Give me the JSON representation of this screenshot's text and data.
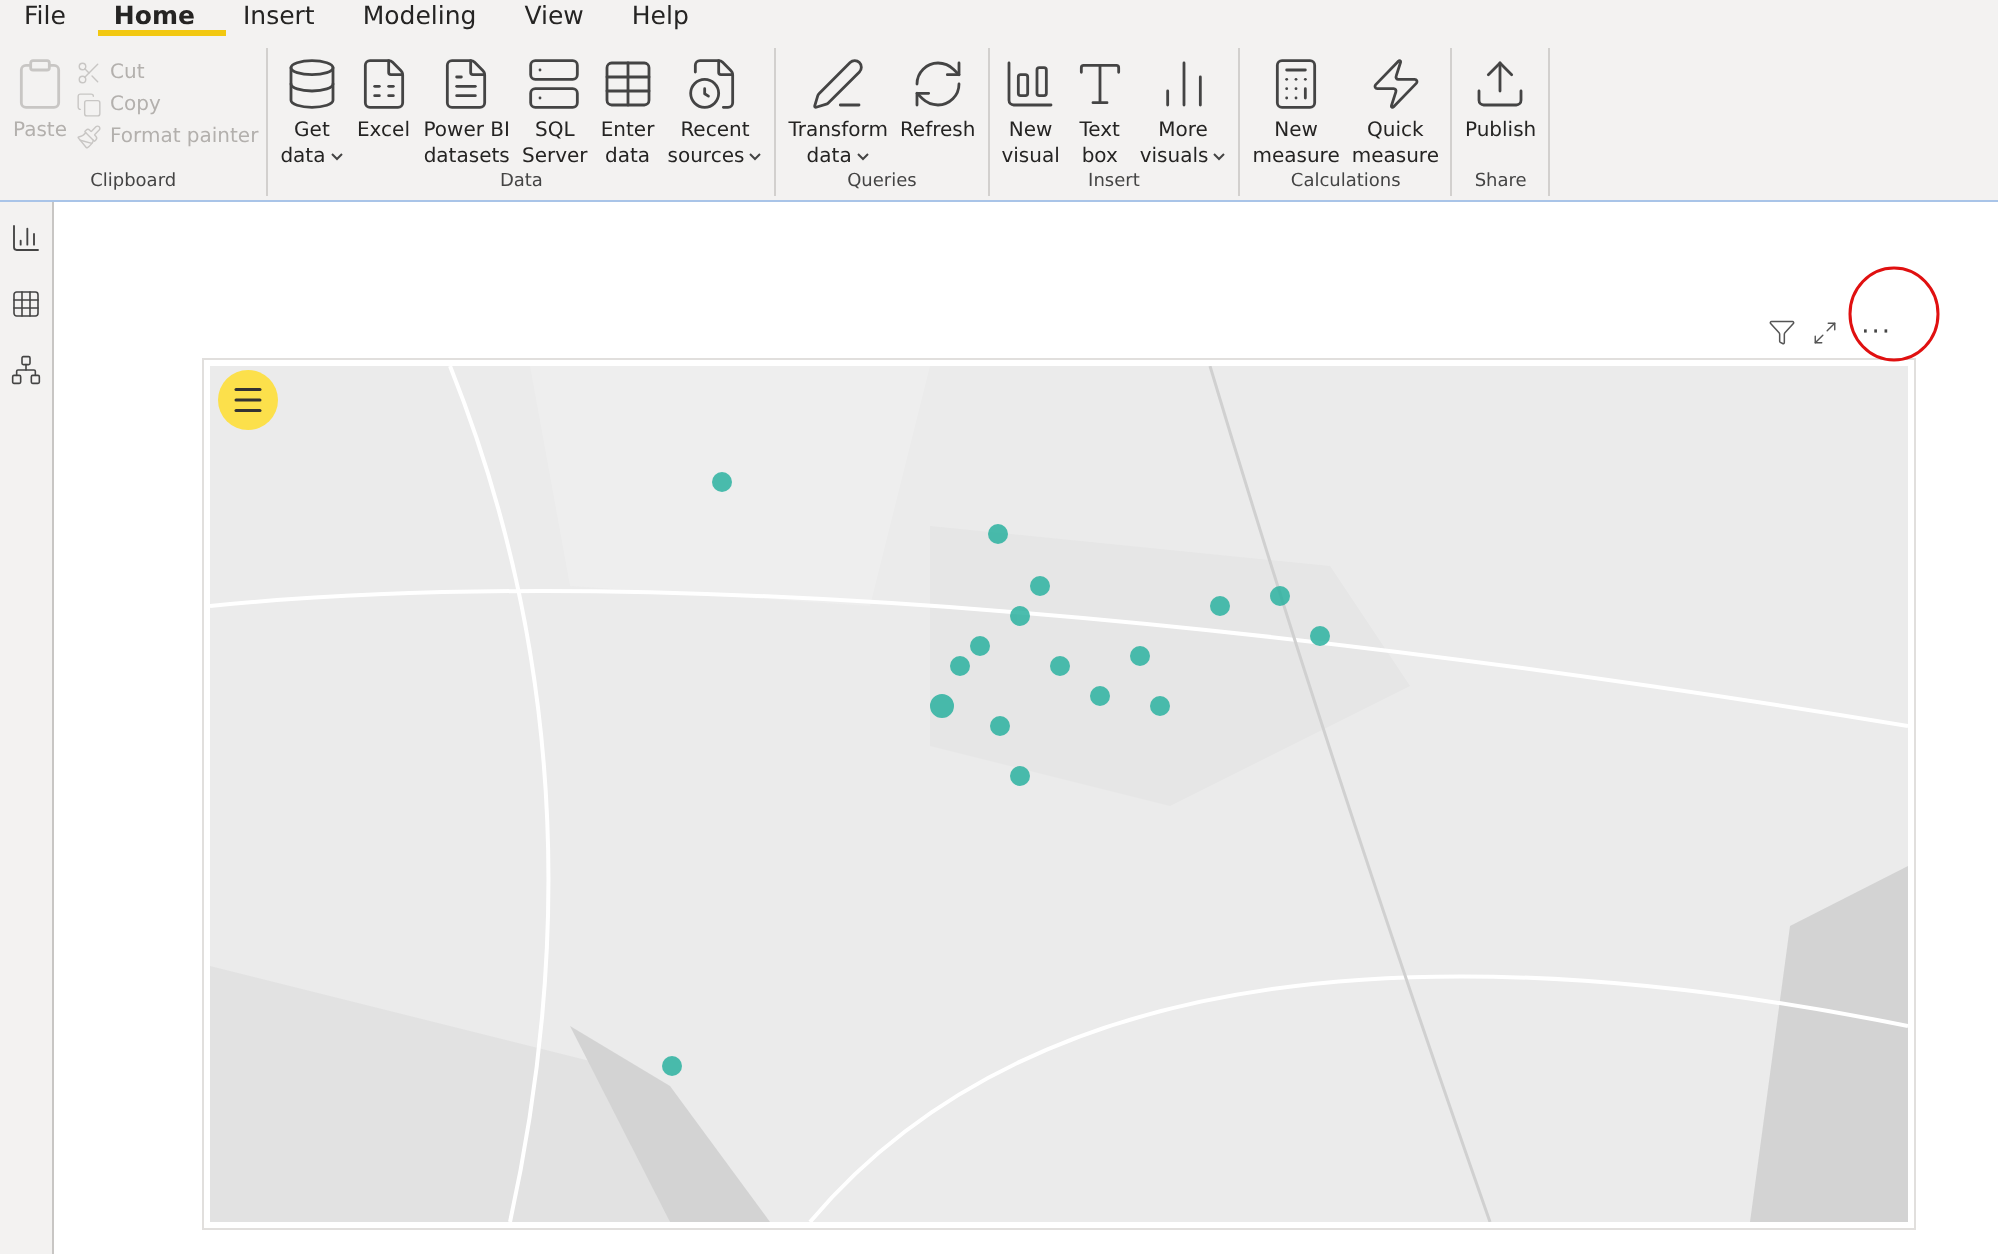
{
  "menu_tabs": [
    {
      "label": "File",
      "selected": false
    },
    {
      "label": "Home",
      "selected": true
    },
    {
      "label": "Insert",
      "selected": false
    },
    {
      "label": "Modeling",
      "selected": false
    },
    {
      "label": "View",
      "selected": false
    },
    {
      "label": "Help",
      "selected": false
    }
  ],
  "ribbon_groups": [
    {
      "label": "Clipboard",
      "items": [
        {
          "kind": "large",
          "lines": [
            "Paste"
          ],
          "disabled": true
        },
        {
          "kind": "small",
          "lines": [
            "Cut"
          ],
          "disabled": true
        },
        {
          "kind": "small",
          "lines": [
            "Copy"
          ],
          "disabled": true
        },
        {
          "kind": "small",
          "lines": [
            "Format painter"
          ],
          "disabled": true
        }
      ]
    },
    {
      "label": "Data",
      "items": [
        {
          "kind": "large",
          "lines": [
            "Get",
            "data"
          ],
          "dropdown": true,
          "disabled": false
        },
        {
          "kind": "large",
          "lines": [
            "Excel"
          ],
          "disabled": false
        },
        {
          "kind": "large",
          "lines": [
            "Power BI",
            "datasets"
          ],
          "disabled": false
        },
        {
          "kind": "large",
          "lines": [
            "SQL",
            "Server"
          ],
          "disabled": false
        },
        {
          "kind": "large",
          "lines": [
            "Enter",
            "data"
          ],
          "disabled": false
        },
        {
          "kind": "large",
          "lines": [
            "Recent",
            "sources"
          ],
          "dropdown": true,
          "disabled": false
        }
      ]
    },
    {
      "label": "Queries",
      "items": [
        {
          "kind": "large",
          "lines": [
            "Transform",
            "data"
          ],
          "dropdown": true,
          "disabled": false
        },
        {
          "kind": "large",
          "lines": [
            "Refresh"
          ],
          "disabled": false
        }
      ]
    },
    {
      "label": "Insert",
      "items": [
        {
          "kind": "large",
          "lines": [
            "New",
            "visual"
          ],
          "disabled": false
        },
        {
          "kind": "large",
          "lines": [
            "Text",
            "box"
          ],
          "disabled": false
        },
        {
          "kind": "large",
          "lines": [
            "More",
            "visuals"
          ],
          "dropdown": true,
          "disabled": false
        }
      ]
    },
    {
      "label": "Calculations",
      "items": [
        {
          "kind": "large",
          "lines": [
            "New",
            "measure"
          ],
          "disabled": false
        },
        {
          "kind": "large",
          "lines": [
            "Quick",
            "measure"
          ],
          "disabled": false
        }
      ]
    },
    {
      "label": "Share",
      "items": [
        {
          "kind": "large",
          "lines": [
            "Publish"
          ],
          "disabled": false
        }
      ]
    }
  ],
  "visual": {
    "more_options": "···"
  }
}
